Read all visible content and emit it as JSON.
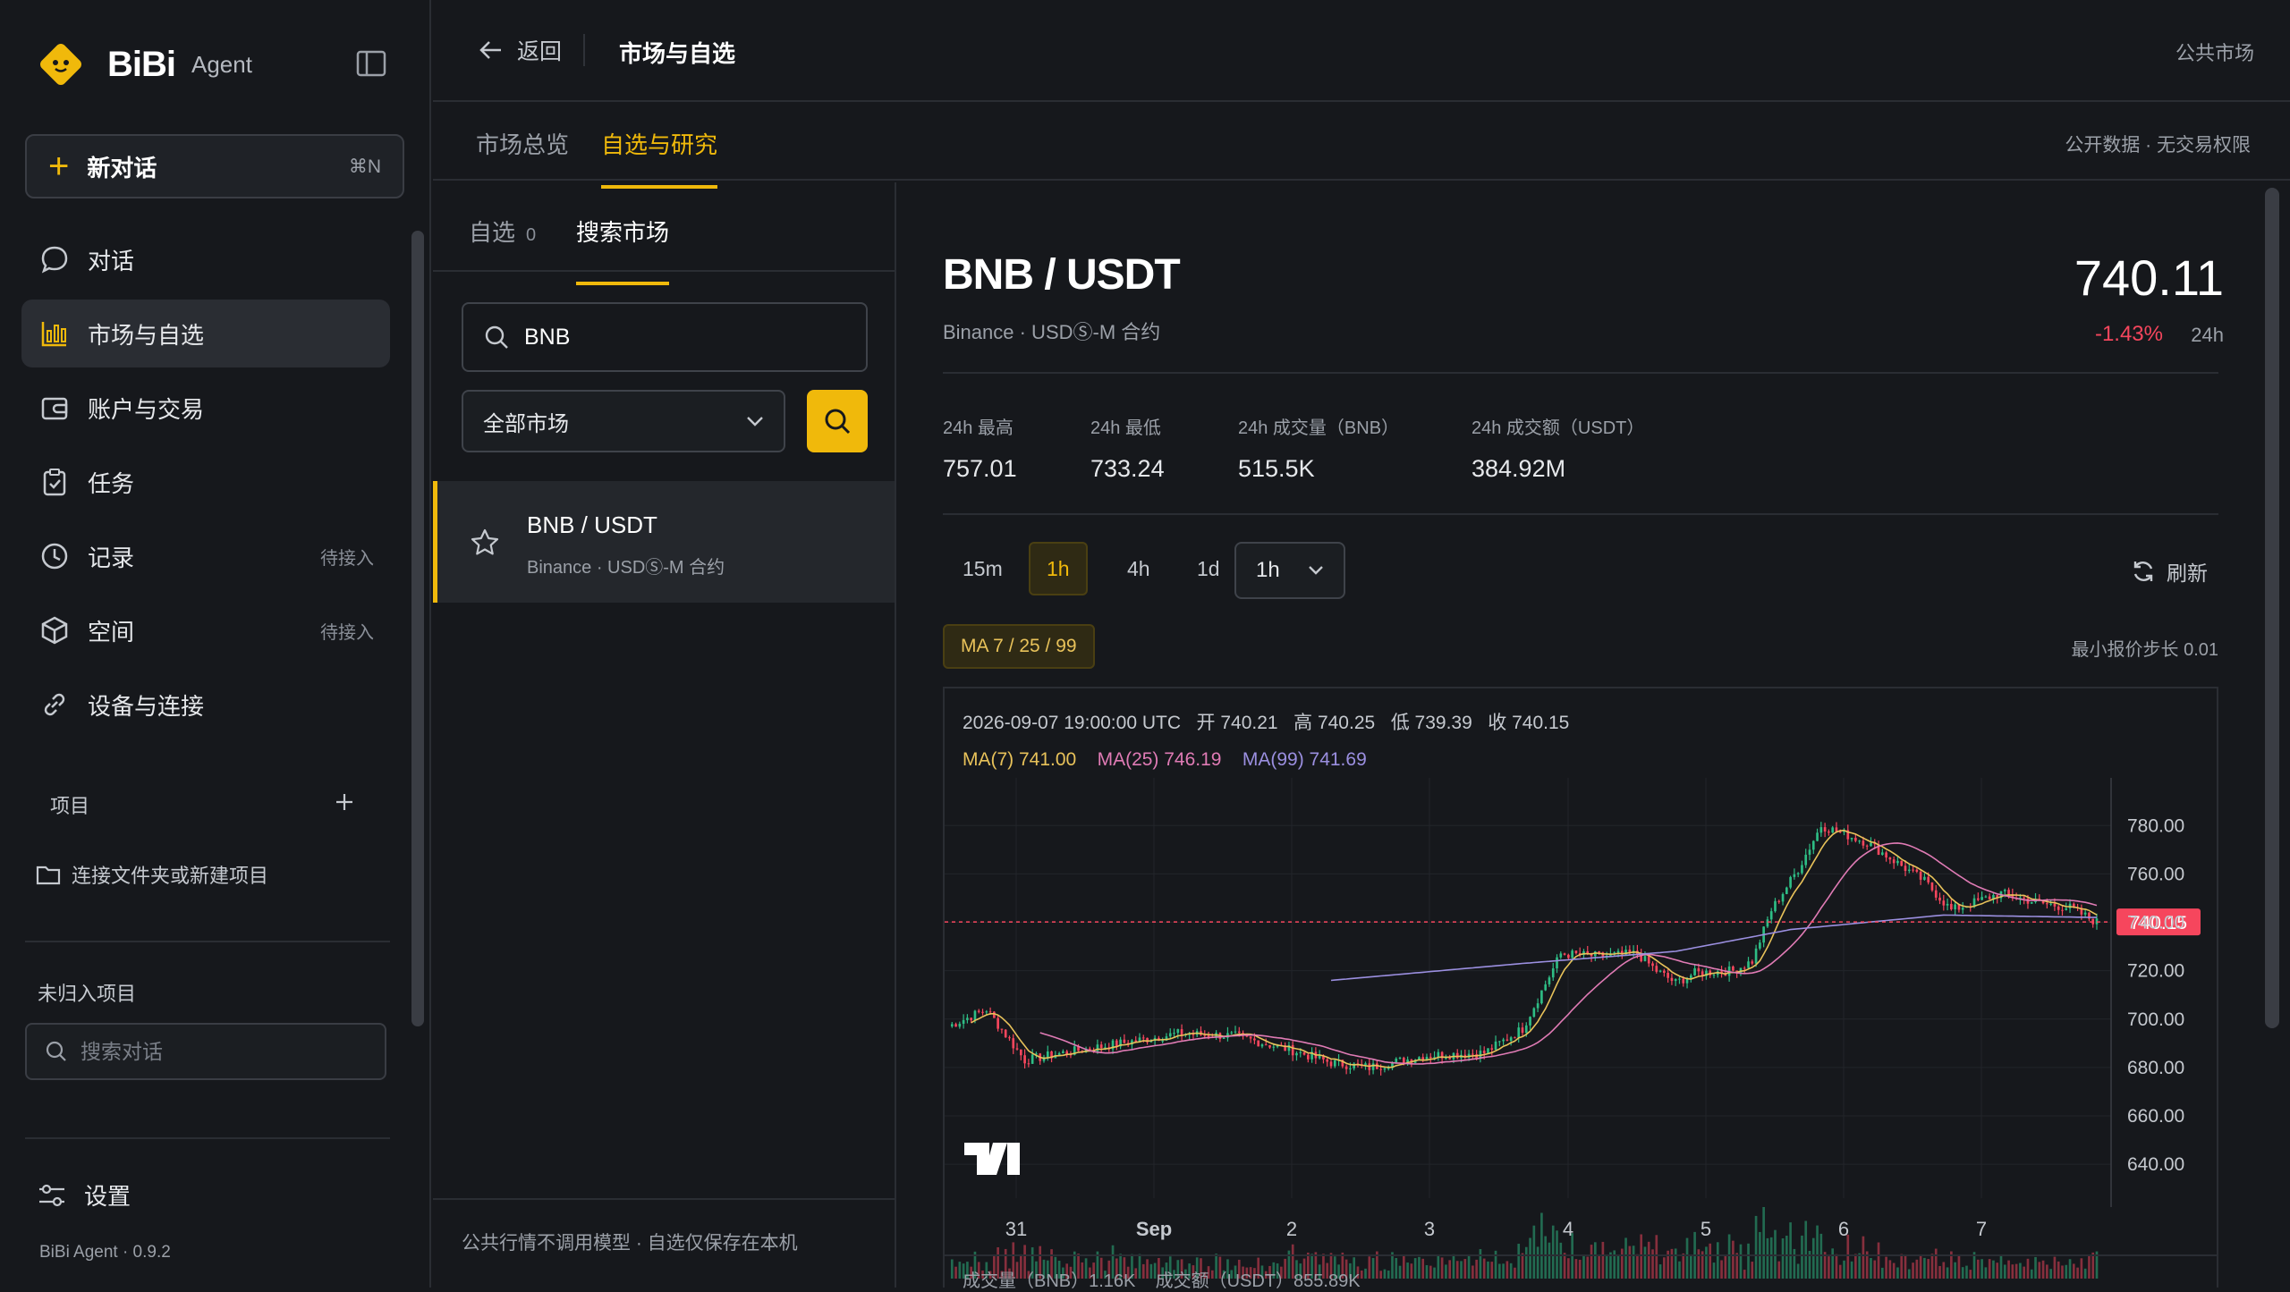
{
  "sidebar": {
    "brand": "BiBi",
    "brand_suffix": "Agent",
    "new_chat": {
      "label": "新对话",
      "shortcut": "⌘N"
    },
    "nav": [
      {
        "label": "对话",
        "icon": "chat-bubble-icon",
        "status": ""
      },
      {
        "label": "市场与自选",
        "icon": "chart-bars-icon",
        "status": "",
        "active": true
      },
      {
        "label": "账户与交易",
        "icon": "wallet-icon",
        "status": ""
      },
      {
        "label": "任务",
        "icon": "clipboard-icon",
        "status": ""
      },
      {
        "label": "记录",
        "icon": "clock-icon",
        "status": "待接入"
      },
      {
        "label": "空间",
        "icon": "cube-icon",
        "status": "待接入"
      },
      {
        "label": "设备与连接",
        "icon": "link-icon",
        "status": ""
      }
    ],
    "projects_title": "项目",
    "connect_folder": "连接文件夹或新建项目",
    "unassigned_title": "未归入项目",
    "search_placeholder": "搜索对话",
    "settings": "设置",
    "version": "BiBi Agent · 0.9.2"
  },
  "topbar": {
    "back": "返回",
    "title": "市场与自选",
    "right": "公共市场"
  },
  "tabs": {
    "items": [
      "市场总览",
      "自选与研究"
    ],
    "active": 1,
    "right": "公开数据 · 无交易权限"
  },
  "leftpanel": {
    "subtabs": [
      {
        "label": "自选",
        "count": "0"
      },
      {
        "label": "搜索市场",
        "count": ""
      }
    ],
    "search_value": "BNB",
    "market_select": "全部市场",
    "result": {
      "symbol": "BNB / USDT",
      "sub": "Binance · USDⓈ-M 合约"
    },
    "footer": "公共行情不调用模型 · 自选仅保存在本机"
  },
  "main": {
    "pair": "BNB / USDT",
    "pair_sub": "Binance · USDⓈ-M 合约",
    "price": "740.11",
    "change": "-1.43%",
    "change_period": "24h",
    "stats": [
      {
        "label": "24h 最高",
        "value": "757.01"
      },
      {
        "label": "24h 最低",
        "value": "733.24"
      },
      {
        "label": "24h 成交量（BNB）",
        "value": "515.5K"
      },
      {
        "label": "24h 成交额（USDT）",
        "value": "384.92M"
      }
    ],
    "intervals": [
      "15m",
      "1h",
      "4h",
      "1d"
    ],
    "active_interval": "1h",
    "interval_select": "1h",
    "refresh": "刷新",
    "ma_badge": "MA 7 / 25 / 99",
    "tick_size": "最小报价步长 0.01"
  },
  "chart_data": {
    "type": "candlestick",
    "ohlc_legend": {
      "time": "2026-09-07 19:00:00 UTC",
      "open": "开 740.21",
      "high": "高 740.25",
      "low": "低 739.39",
      "close": "收 740.15"
    },
    "ma_legend": [
      {
        "label": "MA(7) 741.00",
        "color": "#e8c25a"
      },
      {
        "label": "MA(25) 746.19",
        "color": "#e07bb5"
      },
      {
        "label": "MA(99) 741.69",
        "color": "#9b8fe0"
      }
    ],
    "y_ticks": [
      780,
      760,
      740,
      720,
      700,
      680,
      660,
      640
    ],
    "ylim": [
      626,
      796
    ],
    "x_ticks": [
      "31",
      "Sep",
      "2",
      "3",
      "4",
      "5",
      "6",
      "7"
    ],
    "last_price_label": "740.15",
    "volume_legend": "成交量（BNB）1.16K    成交额（USDT）855.89K",
    "up_color": "#2ebd85",
    "down_color": "#f6465d",
    "close_anchors": [
      [
        0,
        697
      ],
      [
        10,
        704
      ],
      [
        20,
        683
      ],
      [
        30,
        686
      ],
      [
        45,
        690
      ],
      [
        60,
        694
      ],
      [
        75,
        693
      ],
      [
        90,
        687
      ],
      [
        100,
        682
      ],
      [
        110,
        680
      ],
      [
        125,
        685
      ],
      [
        140,
        686
      ],
      [
        150,
        696
      ],
      [
        160,
        727
      ],
      [
        170,
        726
      ],
      [
        180,
        727
      ],
      [
        185,
        720
      ],
      [
        190,
        715
      ],
      [
        195,
        719
      ],
      [
        205,
        720
      ],
      [
        210,
        724
      ],
      [
        215,
        745
      ],
      [
        222,
        762
      ],
      [
        228,
        780
      ],
      [
        240,
        773
      ],
      [
        255,
        757
      ],
      [
        262,
        745
      ],
      [
        275,
        752
      ],
      [
        285,
        748
      ],
      [
        293,
        746
      ],
      [
        300,
        740
      ]
    ],
    "ma99_anchors": [
      [
        100,
        716
      ],
      [
        150,
        723
      ],
      [
        190,
        728
      ],
      [
        220,
        737
      ],
      [
        260,
        743
      ],
      [
        300,
        742
      ]
    ]
  }
}
